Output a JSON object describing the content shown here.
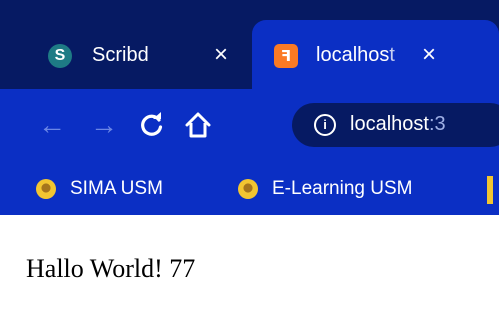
{
  "tabs": [
    {
      "title": "Scribd",
      "favicon": "scribd-icon",
      "favicon_glyph": "S",
      "active": false,
      "close": "×"
    },
    {
      "title": "localhost",
      "favicon": "xampp-icon",
      "favicon_glyph": "ꟻ",
      "active": true,
      "close": "×"
    }
  ],
  "toolbar": {
    "back": "←",
    "forward": "→",
    "reload": "C",
    "home": "⌂",
    "info": "i",
    "url_host": "localhost",
    "url_port": ":3"
  },
  "bookmarks": [
    {
      "label": "SIMA USM",
      "icon": "usm-logo-icon"
    },
    {
      "label": "E-Learning USM",
      "icon": "usm-logo-icon"
    }
  ],
  "page": {
    "text": "Hallo World! 77"
  },
  "colors": {
    "tabstrip": "#061a63",
    "toolbar": "#0b2fc4",
    "xampp": "#fb7a24",
    "scribd": "#1e7b85",
    "bookmark_icon": "#f2c531"
  }
}
